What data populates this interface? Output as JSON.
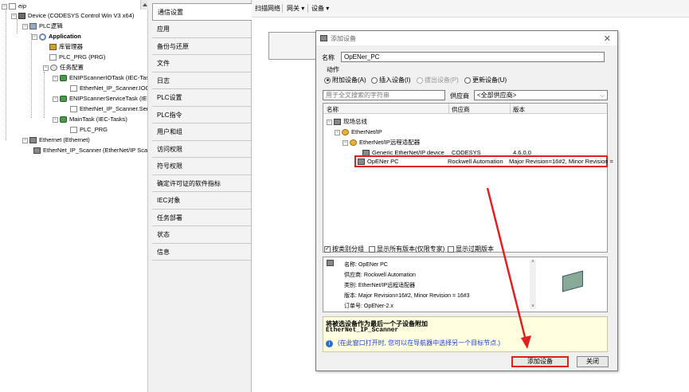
{
  "tree": {
    "root": "eip",
    "device": "Device (CODESYS Control Win V3 x64)",
    "plc_logic": "PLC逻辑",
    "application": "Application",
    "library_manager": "库管理器",
    "plc_prg": "PLC_PRG (PRG)",
    "task_config": "任务配置",
    "task1": "ENIPScannerIOTask (IEC-Tasks)",
    "task1_child": "EtherNet_IP_Scanner.IOCyc",
    "task2": "ENIPScannerServiceTask (IEC-Ta",
    "task2_child": "EtherNet_IP_Scanner.Servic",
    "task3": "MainTask (IEC-Tasks)",
    "task3_child": "PLC_PRG",
    "ethernet": "Ethernet (Ethernet)",
    "scanner": "EtherNet_IP_Scanner (EtherNet/IP Scann"
  },
  "nav": {
    "items": [
      "通信设置",
      "应用",
      "备份与还原",
      "文件",
      "日志",
      "PLC设置",
      "PLC指令",
      "用户和组",
      "访问权限",
      "符号权限",
      "确定许可证的软件指标",
      "IEC对象",
      "任务部署",
      "状态",
      "信息"
    ]
  },
  "toolbar": {
    "scan_network": "扫描网络",
    "gateway": "网关",
    "device": "设备",
    "dropdown_arrow": "▾"
  },
  "dialog": {
    "title": "添加设备",
    "close_glyph": "✕",
    "name_label": "名称",
    "name_value": "OpENer_PC",
    "action_label": "动作",
    "actions": [
      "附加设备(A)",
      "插入设备(I)",
      "拔出设备(P)",
      "更新设备(U)"
    ],
    "search_placeholder": "用于全文搜索的字符串",
    "vendor_label": "供应商",
    "vendor_value": "<全部供应商>",
    "columns": [
      "名称",
      "供应商",
      "版本"
    ],
    "rows": {
      "fieldbus": "现场总线",
      "ethernetip": "EtherNet/IP",
      "adapter": "EtherNet/IP远程适配器",
      "generic_name": "Generic EtherNet/IP device",
      "generic_vendor": "CODESYS",
      "generic_version": "4.6.0.0",
      "opener_name": "OpENer PC",
      "opener_vendor": "Rockwell Automation",
      "opener_version": "Major Revision=16#2, Minor Revision ="
    },
    "options": [
      "按类别分组",
      "显示所有版本(仅限专家)",
      "显示过期版本"
    ],
    "info": {
      "name": "名称: OpENer PC",
      "vendor": "供应商: Rockwell Automation",
      "category": "类别: EtherNet/IP远程适配器",
      "version": "版本: Major Revision=16#2, Minor Revision = 16#3",
      "order": "订单号: OpENer-2.x"
    },
    "hint_title": "将被选设备作为最后一个子设备附加",
    "hint_target": "EtherNet_IP_Scanner",
    "hint_info": "(在此窗口打开时, 您可以在导航器中选择另一个目标节点.)",
    "add_button": "添加设备",
    "close_button": "关闭"
  },
  "colors": {
    "highlight": "#e02020",
    "hint_bg": "#ffffe0"
  }
}
